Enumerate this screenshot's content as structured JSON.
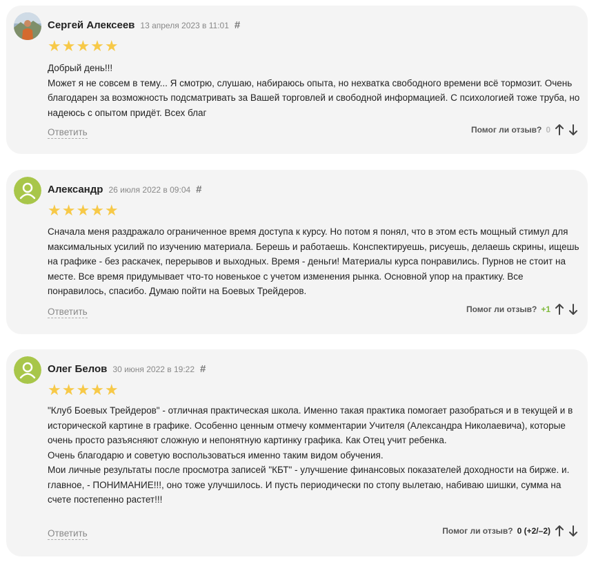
{
  "ui": {
    "helpful_label": "Помог ли отзыв?",
    "reply_label": "Ответить",
    "hash": "#",
    "stars": "★★★★★",
    "star_color": "#f7c948",
    "avatar_color": "#a8c64a",
    "score_positive_color": "#7fb93b"
  },
  "reviews": [
    {
      "author": "Сергей Алексеев",
      "date": "13 апреля 2023 в 11:01",
      "rating": 5,
      "paragraphs": [
        "Добрый день!!!",
        "Может я не совсем в тему... Я смотрю, слушаю, набираюсь опыта, но нехватка свободного времени всё тормозит. Очень благодарен за возможность подсматривать за Вашей торговлей и свободной информацией. С психологией тоже труба, но надеюсь с опытом придёт. Всех благ"
      ],
      "score": "0",
      "avatar": "photo"
    },
    {
      "author": "Александр",
      "date": "26 июля 2022 в 09:04",
      "rating": 5,
      "paragraphs": [
        "Сначала меня раздражало ограниченное время доступа к курсу. Но потом я понял, что в этом есть мощный стимул для максимальных усилий по изучению материала. Берешь и работаешь. Конспектируешь, рисуешь, делаешь скрины, ищешь на графике - без раскачек, перерывов и выходных. Время - деньги! Материалы курса понравились. Пурнов не стоит на месте. Все время придумывает что-то новенькое с учетом изменения рынка. Основной упор на практику. Все понравилось, спасибо. Думаю пойти на Боевых Трейдеров."
      ],
      "score": "+1",
      "avatar": "user-icon"
    },
    {
      "author": "Олег Белов",
      "date": "30 июня 2022 в 19:22",
      "rating": 5,
      "paragraphs": [
        "\"Клуб Боевых Трейдеров\" - отличная практическая школа. Именно такая практика помогает разобраться и в текущей и в исторической картине в графике. Особенно ценным отмечу комментарии Учителя (Александра Николаевича), которые очень просто разъясняют сложную и непонятную картинку графика. Как Отец учит ребенка.",
        "Очень благодарю и советую воспользоваться именно таким видом обучения.",
        "Мои личные результаты после просмотра записей \"КБТ\" - улучшение финансовых показателей доходности на бирже. и. главное, - ПОНИМАНИЕ!!!, оно тоже улучшилось. И пусть периодически по стопу вылетаю, набиваю шишки, сумма на счете постепенно растет!!!"
      ],
      "score": "0 (+2/–2)",
      "avatar": "user-icon"
    }
  ]
}
